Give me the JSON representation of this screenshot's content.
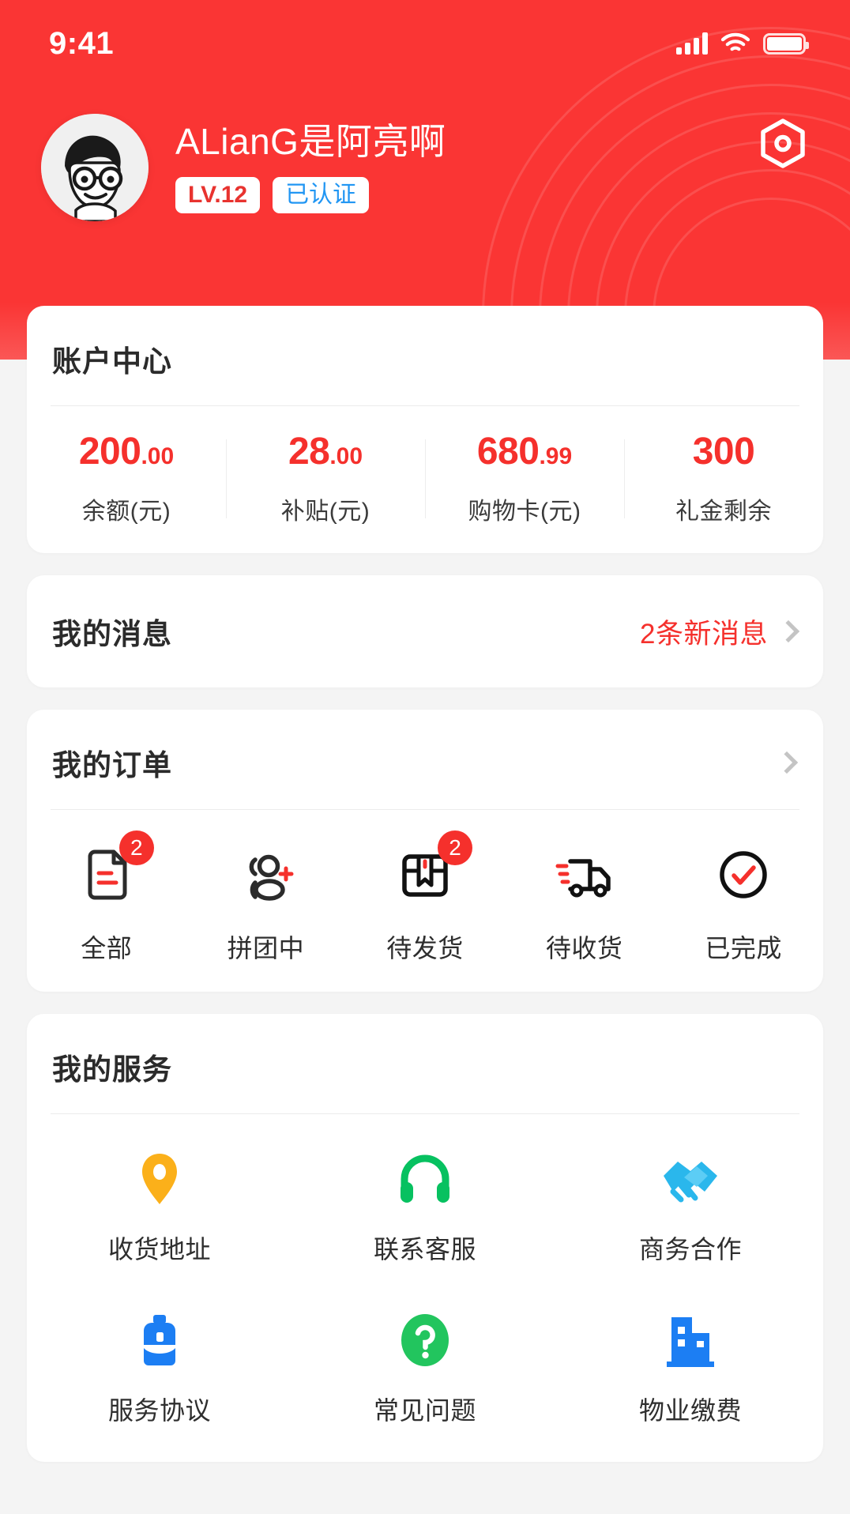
{
  "status_bar": {
    "time": "9:41",
    "signal_icon": "cellular-signal-icon",
    "wifi_icon": "wifi-icon",
    "battery_icon": "battery-icon"
  },
  "header": {
    "settings_icon": "settings-hexagon-icon",
    "avatar_icon": "user-avatar",
    "user_name": "ALianG是阿亮啊",
    "level_badge": "LV.12",
    "verified_badge": "已认证",
    "background_color": "#fa3534"
  },
  "account_center": {
    "title": "账户中心",
    "stats": [
      {
        "int": "200",
        "dec": ".00",
        "label": "余额(元)"
      },
      {
        "int": "28",
        "dec": ".00",
        "label": "补贴(元)"
      },
      {
        "int": "680",
        "dec": ".99",
        "label": "购物卡(元)"
      },
      {
        "int": "300",
        "dec": "",
        "label": "礼金剩余"
      }
    ],
    "value_color": "#f5302c"
  },
  "messages": {
    "title": "我的消息",
    "count_text": "2条新消息",
    "chevron_icon": "chevron-right-icon",
    "count_color": "#f5302c"
  },
  "orders": {
    "title": "我的订单",
    "chevron_icon": "chevron-right-icon",
    "items": [
      {
        "label": "全部",
        "icon": "document-icon",
        "badge": "2"
      },
      {
        "label": "拼团中",
        "icon": "group-add-icon",
        "badge": ""
      },
      {
        "label": "待发货",
        "icon": "package-box-icon",
        "badge": "2"
      },
      {
        "label": "待收货",
        "icon": "delivery-truck-icon",
        "badge": ""
      },
      {
        "label": "已完成",
        "icon": "check-circle-icon",
        "badge": ""
      }
    ]
  },
  "services": {
    "title": "我的服务",
    "items": [
      {
        "label": "收货地址",
        "icon": "location-pin-icon",
        "color": "#fbb01a"
      },
      {
        "label": "联系客服",
        "icon": "headphones-icon",
        "color": "#07c160"
      },
      {
        "label": "商务合作",
        "icon": "handshake-icon",
        "color": "#2ab7ec"
      },
      {
        "label": "服务协议",
        "icon": "briefcase-icon",
        "color": "#1c7ef3"
      },
      {
        "label": "常见问题",
        "icon": "question-circle-icon",
        "color": "#22c55e"
      },
      {
        "label": "物业缴费",
        "icon": "building-icon",
        "color": "#1c7ef3"
      }
    ]
  }
}
